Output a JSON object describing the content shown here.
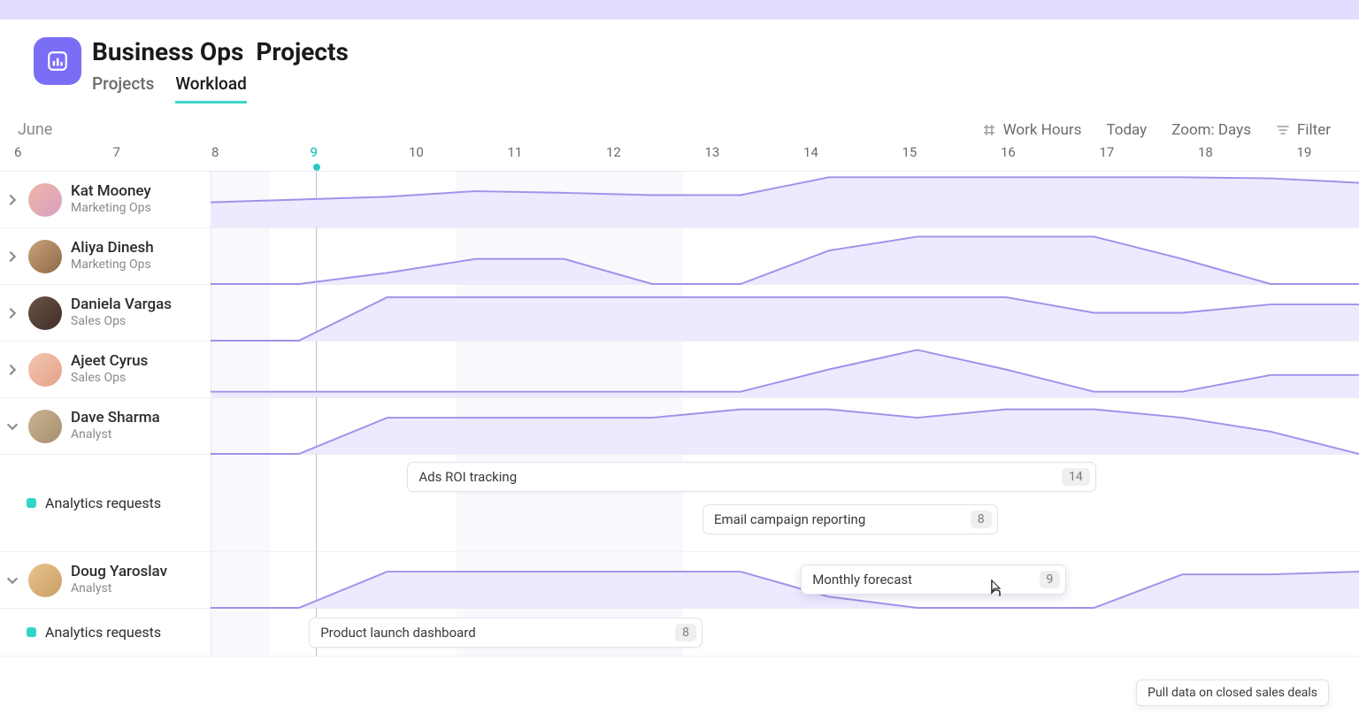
{
  "header": {
    "team": "Business Ops",
    "section": "Projects"
  },
  "tabs": [
    {
      "label": "Projects",
      "active": false
    },
    {
      "label": "Workload",
      "active": true
    }
  ],
  "toolbar": {
    "month": "June",
    "workhours_label": "Work Hours",
    "today_label": "Today",
    "zoom_label": "Zoom: Days",
    "filter_label": "Filter"
  },
  "timeline": {
    "dates": [
      "6",
      "7",
      "8",
      "9",
      "10",
      "11",
      "12",
      "13",
      "14",
      "15",
      "16",
      "17",
      "18",
      "19"
    ],
    "today_index": 3
  },
  "people": [
    {
      "name": "Kat Mooney",
      "role": "Marketing Ops",
      "avatar": "a1",
      "expand": "right"
    },
    {
      "name": "Aliya Dinesh",
      "role": "Marketing Ops",
      "avatar": "a2",
      "expand": "right"
    },
    {
      "name": "Daniela Vargas",
      "role": "Sales Ops",
      "avatar": "a3",
      "expand": "right"
    },
    {
      "name": "Ajeet Cyrus",
      "role": "Sales Ops",
      "avatar": "a4",
      "expand": "right"
    },
    {
      "name": "Dave Sharma",
      "role": "Analyst",
      "avatar": "a5",
      "expand": "down",
      "group": {
        "label": "Analytics requests",
        "tasks": [
          {
            "name": "Ads ROI tracking",
            "count": "14",
            "start_idx": 4,
            "span": 7
          },
          {
            "name": "Email campaign reporting",
            "count": "8",
            "start_idx": 7,
            "span": 3
          }
        ]
      }
    },
    {
      "name": "Doug Yaroslav",
      "role": "Analyst",
      "avatar": "a6",
      "expand": "down",
      "group": {
        "label": "Analytics requests",
        "tasks": [
          {
            "name": "Product launch dashboard",
            "count": "8",
            "start_idx": 3,
            "span": 4
          },
          {
            "name": "Monthly forecast",
            "count": "9",
            "start_idx": 8,
            "span": 2.7,
            "hovered": true,
            "overlay": true
          }
        ]
      }
    }
  ],
  "tooltip": {
    "text": "Pull data on closed sales deals"
  },
  "colors": {
    "accent": "#7b6ef6",
    "teal": "#30d5c8"
  }
}
